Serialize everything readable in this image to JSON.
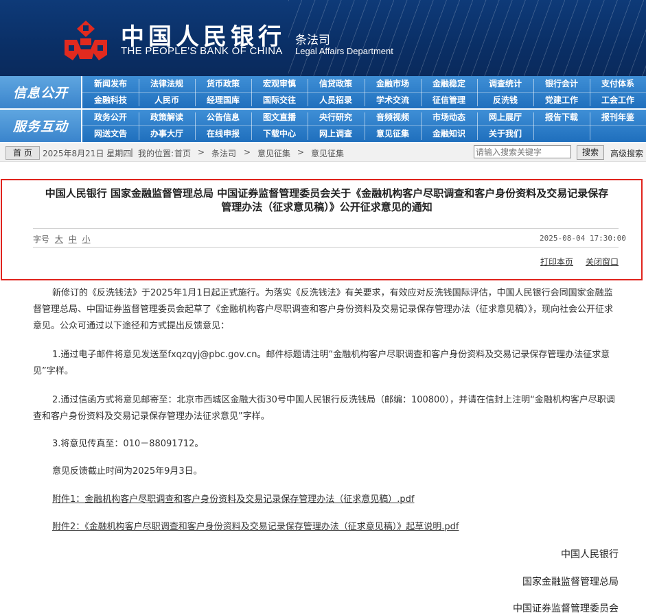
{
  "header": {
    "bank_name_cn": "中国人民银行",
    "bank_name_en": "THE PEOPLE'S BANK OF CHINA",
    "department_cn": "条法司",
    "department_en": "Legal Affairs Department",
    "logo_icon": "pboc-logo-icon",
    "brand_color": "#0e3a78"
  },
  "nav": {
    "row1_title": "信息公开",
    "row2_title": "服务互动",
    "row1_links": [
      [
        "新闻发布",
        "法律法规",
        "货币政策",
        "宏观审慎",
        "信贷政策",
        "金融市场",
        "金融稳定",
        "调查统计",
        "银行会计",
        "支付体系"
      ],
      [
        "金融科技",
        "人民币",
        "经理国库",
        "国际交往",
        "人员招录",
        "学术交流",
        "征信管理",
        "反洗钱",
        "党建工作",
        "工会工作"
      ]
    ],
    "row2_links": [
      [
        "政务公开",
        "政策解读",
        "公告信息",
        "图文直播",
        "央行研究",
        "音频视频",
        "市场动态",
        "网上展厅",
        "报告下载",
        "报刊年鉴"
      ],
      [
        "网送文告",
        "办事大厅",
        "在线申报",
        "下载中心",
        "网上调查",
        "意见征集",
        "金融知识",
        "关于我们"
      ]
    ]
  },
  "breadcrumb": {
    "home_label": "首 页",
    "date": "2025年8月21日 星期四",
    "location_label": "我的位置:",
    "items": [
      "首页",
      "条法司",
      "意见征集",
      "意见征集"
    ],
    "separator": ">",
    "search_placeholder": "请输入搜索关键字",
    "search_button": "搜索",
    "advanced_search": "高级搜索"
  },
  "article": {
    "title_line1": "中国人民银行 国家金融监督管理总局 中国证券监督管理委员会关于《金融机构客户尽职调查和客户身份资料及交易记录保存",
    "title_line2": "管理办法（征求意见稿）》公开征求意见的通知",
    "font_size_label": "字号",
    "font_large": "大",
    "font_medium": "中",
    "font_small": "小",
    "publish_date": "2025-08-04 17:30:00",
    "print_label": "打印本页",
    "close_label": "关闭窗口",
    "paragraphs": [
      "新修订的《反洗钱法》于2025年1月1日起正式施行。为落实《反洗钱法》有关要求，有效应对反洗钱国际评估，中国人民银行会同国家金融监督管理总局、中国证券监督管理委员会起草了《金融机构客户尽职调查和客户身份资料及交易记录保存管理办法（征求意见稿）》，现向社会公开征求意见。公众可通过以下途径和方式提出反馈意见：",
      "1.通过电子邮件将意见发送至fxqzqyj@pbc.gov.cn。邮件标题请注明“金融机构客户尽职调查和客户身份资料及交易记录保存管理办法征求意见”字样。",
      "2.通过信函方式将意见邮寄至：北京市西城区金融大街30号中国人民银行反洗钱局（邮编：100800），并请在信封上注明“金融机构客户尽职调查和客户身份资料及交易记录保存管理办法征求意见”字样。",
      "3.将意见传真至：010－88091712。",
      "意见反馈截止时间为2025年9月3日。"
    ],
    "attachments": [
      "附件1：金融机构客户尽职调查和客户身份资料及交易记录保存管理办法（征求意见稿）.pdf",
      "附件2：《金融机构客户尽职调查和客户身份资料及交易记录保存管理办法（征求意见稿）》起草说明.pdf"
    ],
    "signatures": [
      "中国人民银行",
      "国家金融监督管理总局",
      "中国证券监督管理委员会"
    ]
  }
}
